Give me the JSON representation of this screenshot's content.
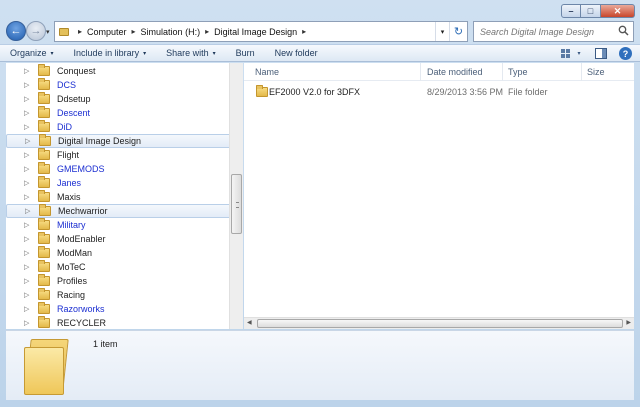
{
  "window": {
    "controls": {
      "minimize": "–",
      "maximize": "□",
      "close": "✕"
    }
  },
  "nav": {
    "back": "←",
    "forward": "→",
    "history": "▾"
  },
  "address": {
    "crumbs": [
      "Computer",
      "Simulation (H:)",
      "Digital Image Design"
    ],
    "separator": "▸",
    "dropdown": "▾",
    "refresh": "↻"
  },
  "search": {
    "placeholder": "Search Digital Image Design",
    "icon": "search-icon"
  },
  "toolbar": {
    "organize": "Organize",
    "include_in_library": "Include in library",
    "share_with": "Share with",
    "burn": "Burn",
    "new_folder": "New folder",
    "caret": "▾",
    "help": "?"
  },
  "tree": [
    {
      "label": "Conquest",
      "blue": false,
      "selected": false
    },
    {
      "label": "DCS",
      "blue": true,
      "selected": false
    },
    {
      "label": "Ddsetup",
      "blue": false,
      "selected": false
    },
    {
      "label": "Descent",
      "blue": true,
      "selected": false
    },
    {
      "label": "DiD",
      "blue": true,
      "selected": false
    },
    {
      "label": "Digital Image Design",
      "blue": false,
      "selected": true
    },
    {
      "label": "Flight",
      "blue": false,
      "selected": false
    },
    {
      "label": "GMEMODS",
      "blue": true,
      "selected": false
    },
    {
      "label": "Janes",
      "blue": true,
      "selected": false
    },
    {
      "label": "Maxis",
      "blue": false,
      "selected": false
    },
    {
      "label": "Mechwarrior",
      "blue": false,
      "selected": true
    },
    {
      "label": "Military",
      "blue": true,
      "selected": false
    },
    {
      "label": "ModEnabler",
      "blue": false,
      "selected": false
    },
    {
      "label": "ModMan",
      "blue": false,
      "selected": false
    },
    {
      "label": "MoTeC",
      "blue": false,
      "selected": false
    },
    {
      "label": "Profiles",
      "blue": false,
      "selected": false
    },
    {
      "label": "Racing",
      "blue": false,
      "selected": false
    },
    {
      "label": "Razorworks",
      "blue": true,
      "selected": false
    },
    {
      "label": "RECYCLER",
      "blue": false,
      "selected": false
    }
  ],
  "expander_glyph": "▷",
  "columns": {
    "name": "Name",
    "date_modified": "Date modified",
    "type": "Type",
    "size": "Size"
  },
  "files": [
    {
      "name": "EF2000 V2.0 for 3DFX",
      "date_modified": "8/29/2013 3:56 PM",
      "type": "File folder",
      "size": ""
    }
  ],
  "status": {
    "item_count": "1 item"
  },
  "colors": {
    "link_blue": "#1b2ed1",
    "accent": "#2f6fbd"
  }
}
